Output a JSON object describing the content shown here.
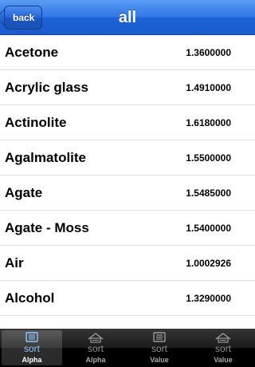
{
  "navbar": {
    "back_label": "back",
    "title": "all"
  },
  "list": {
    "items": [
      {
        "name": "Acetone",
        "value": "1.3600000"
      },
      {
        "name": "Acrylic glass",
        "value": "1.4910000"
      },
      {
        "name": "Actinolite",
        "value": "1.6180000"
      },
      {
        "name": "Agalmatolite",
        "value": "1.5500000"
      },
      {
        "name": "Agate",
        "value": "1.5485000"
      },
      {
        "name": "Agate - Moss",
        "value": "1.5400000"
      },
      {
        "name": "Air",
        "value": "1.0002926"
      },
      {
        "name": "Alcohol",
        "value": "1.3290000"
      },
      {
        "name": "",
        "value": ""
      }
    ]
  },
  "tabbar": {
    "tabs": [
      {
        "icon_text": "sort",
        "label": "Alpha",
        "icon": "sort-list-icon",
        "selected": true
      },
      {
        "icon_text": "sort",
        "label": "Alpha",
        "icon": "sort-house-icon",
        "selected": false
      },
      {
        "icon_text": "sort",
        "label": "Value",
        "icon": "sort-list-icon",
        "selected": false
      },
      {
        "icon_text": "sort",
        "label": "Value",
        "icon": "sort-house-icon",
        "selected": false
      }
    ]
  },
  "colors": {
    "navbar_blue": "#2f78e8",
    "selected_tab_text": "#8fc5ff",
    "separator": "#e0e0e0"
  }
}
